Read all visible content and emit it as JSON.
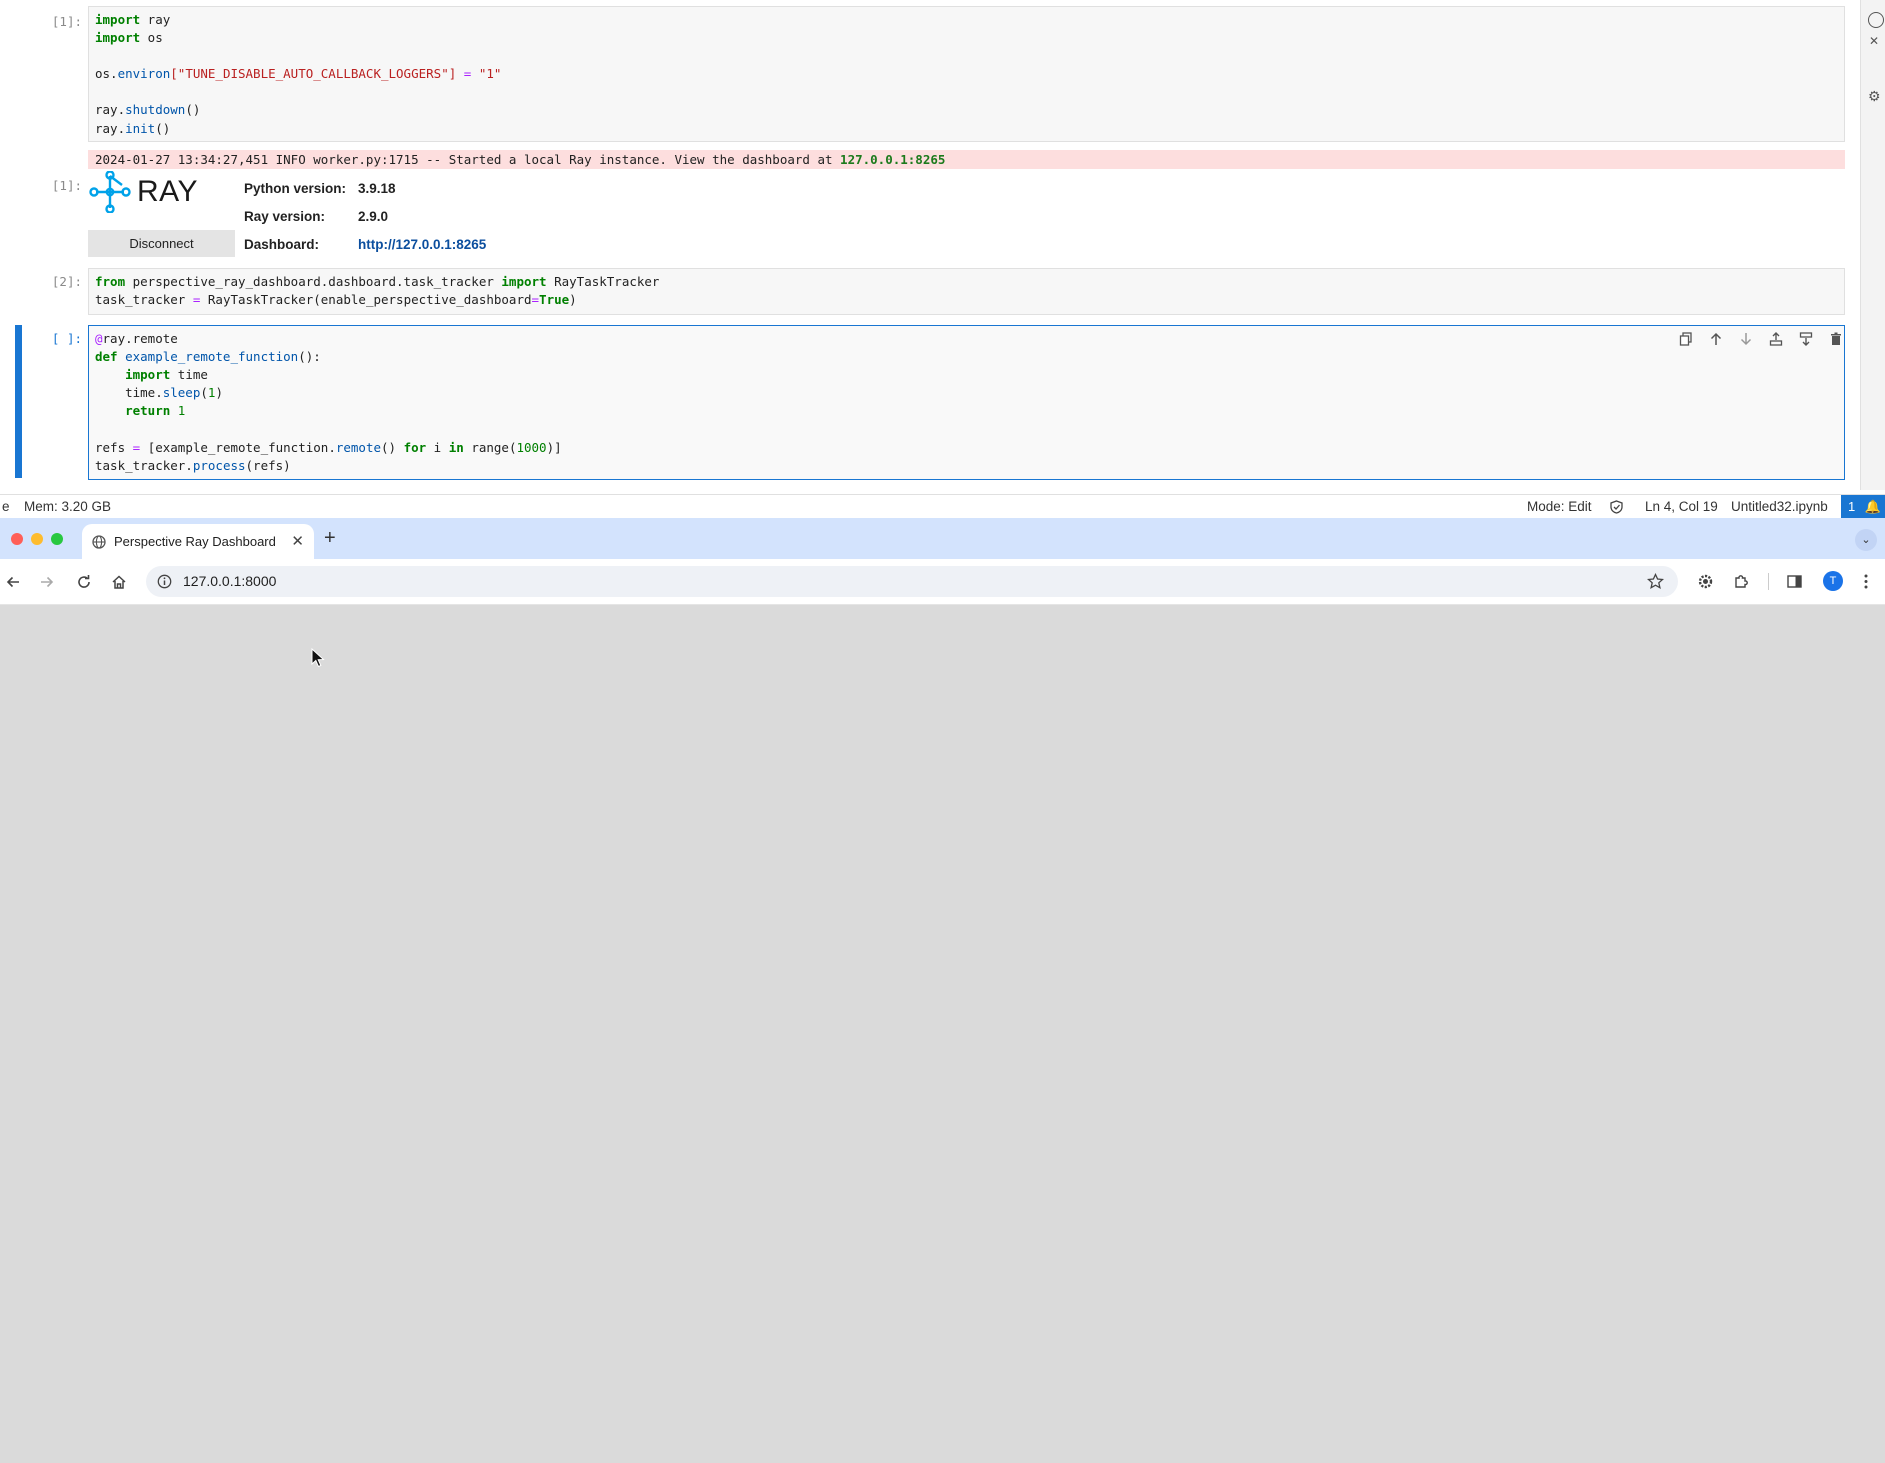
{
  "notebook": {
    "cell1": {
      "prompt": "[1]:",
      "lines": [
        [
          "import",
          " ray"
        ],
        [
          "import",
          " os"
        ]
      ],
      "env_obj": "os.",
      "env_attr": "environ",
      "env_key": "[\"TUNE_DISABLE_AUTO_CALLBACK_LOGGERS\"]",
      "env_eq": " = ",
      "env_val": "\"1\"",
      "shutdown_obj": "ray.",
      "shutdown_fn": "shutdown",
      "shutdown_paren": "()",
      "init_obj": "ray.",
      "init_fn": "init",
      "init_paren": "()"
    },
    "log": {
      "text": "2024-01-27 13:34:27,451 INFO worker.py:1715 -- Started a local Ray instance. View the dashboard at ",
      "link": "127.0.0.1:8265"
    },
    "output1": {
      "prompt": "[1]:",
      "logo_text": "RAY",
      "disconnect_label": "Disconnect",
      "rows": [
        {
          "label": "Python version:",
          "value": "3.9.18"
        },
        {
          "label": "Ray version:",
          "value": "2.9.0"
        },
        {
          "label": "Dashboard:",
          "value": "http://127.0.0.1:8265"
        }
      ]
    },
    "cell2": {
      "prompt": "[2]:",
      "from_kw": "from",
      "module": " perspective_ray_dashboard.dashboard.task_tracker ",
      "import_kw": "import",
      "cls": " RayTaskTracker",
      "line2_a": "task_tracker ",
      "line2_eq": "=",
      "line2_b": " RayTaskTracker(enable_perspective_dashboard",
      "line2_eq2": "=",
      "line2_true": "True",
      "line2_c": ")"
    },
    "cell3": {
      "prompt": "[ ]:",
      "dec_at": "@",
      "dec_rest": "ray.remote",
      "def_kw": "def",
      "fn_name": " example_remote_function",
      "fn_tail": "():",
      "indent_import": "    ",
      "import_kw": "import",
      "import_mod": " time",
      "sleep_obj": "    time.",
      "sleep_fn": "sleep",
      "sleep_open": "(",
      "sleep_num": "1",
      "sleep_close": ")",
      "indent_ret": "    ",
      "return_kw": "return",
      "return_val": " 1",
      "refs_a": "refs ",
      "refs_eq": "=",
      "refs_b": " [example_remote_function.",
      "refs_fn": "remote",
      "refs_c": "() ",
      "for_kw": "for",
      "refs_d": " i ",
      "in_kw": "in",
      "refs_e": " range(",
      "refs_num": "1000",
      "refs_f": ")]",
      "proc_a": "task_tracker.",
      "proc_fn": "process",
      "proc_b": "(refs)"
    }
  },
  "statusbar": {
    "left_fragment": "e",
    "mem": "Mem: 3.20 GB",
    "mode": "Mode: Edit",
    "position": "Ln 4, Col 19",
    "filename": "Untitled32.ipynb",
    "notif_count": "1"
  },
  "browser": {
    "tab_title": "Perspective Ray Dashboard",
    "tab_close": "✕",
    "new_tab": "+",
    "url": "127.0.0.1:8000",
    "avatar_letter": "T"
  },
  "colors": {
    "accent": "#1976d2",
    "log_bg": "#fddede",
    "ray_blue": "#00a2e9",
    "tabbar_bg": "#d3e3fd"
  }
}
